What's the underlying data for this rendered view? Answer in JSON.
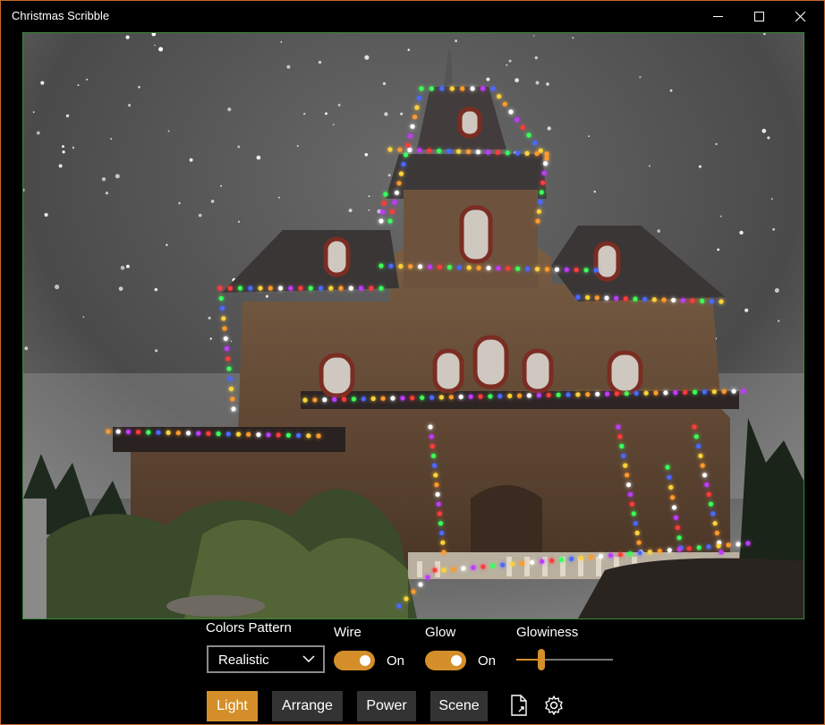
{
  "window": {
    "title": "Christmas Scribble"
  },
  "controls": {
    "colors_pattern": {
      "label": "Colors Pattern",
      "value": "Realistic"
    },
    "wire": {
      "label": "Wire",
      "state": "On"
    },
    "glow": {
      "label": "Glow",
      "state": "On"
    },
    "glowiness": {
      "label": "Glowiness",
      "value_fraction": 0.26
    }
  },
  "tabs": [
    {
      "label": "Light",
      "active": true
    },
    {
      "label": "Arrange",
      "active": false
    },
    {
      "label": "Power",
      "active": false
    },
    {
      "label": "Scene",
      "active": false
    }
  ],
  "icons": {
    "export": "export-file-icon",
    "settings": "gear-icon",
    "dropdown": "chevron-down-icon"
  },
  "colors": {
    "accent": "#d48f2a",
    "tab_inactive": "#333333",
    "canvas_border": "#3a8a3a",
    "window_border": "#c4682a"
  }
}
